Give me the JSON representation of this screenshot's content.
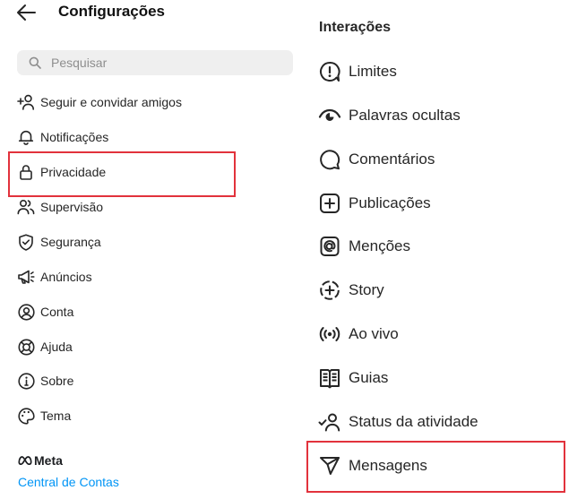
{
  "header": {
    "title": "Configurações"
  },
  "search": {
    "placeholder": "Pesquisar"
  },
  "settings_menu": [
    {
      "label": "Seguir e convidar amigos",
      "icon": "add-person-icon"
    },
    {
      "label": "Notificações",
      "icon": "bell-icon"
    },
    {
      "label": "Privacidade",
      "icon": "lock-icon",
      "highlighted": true
    },
    {
      "label": "Supervisão",
      "icon": "people-icon"
    },
    {
      "label": "Segurança",
      "icon": "shield-check-icon"
    },
    {
      "label": "Anúncios",
      "icon": "megaphone-icon"
    },
    {
      "label": "Conta",
      "icon": "person-circle-icon"
    },
    {
      "label": "Ajuda",
      "icon": "lifebuoy-icon"
    },
    {
      "label": "Sobre",
      "icon": "info-icon"
    },
    {
      "label": "Tema",
      "icon": "palette-icon"
    }
  ],
  "footer": {
    "brand": "Meta",
    "link": "Central de Contas"
  },
  "interactions": {
    "heading": "Interações",
    "items": [
      {
        "label": "Limites",
        "icon": "exclamation-circle-icon"
      },
      {
        "label": "Palavras ocultas",
        "icon": "hidden-eye-icon"
      },
      {
        "label": "Comentários",
        "icon": "comment-bubble-icon"
      },
      {
        "label": "Publicações",
        "icon": "plus-square-icon"
      },
      {
        "label": "Menções",
        "icon": "at-sign-icon"
      },
      {
        "label": "Story",
        "icon": "story-add-icon"
      },
      {
        "label": "Ao vivo",
        "icon": "live-broadcast-icon"
      },
      {
        "label": "Guias",
        "icon": "guide-book-icon"
      },
      {
        "label": "Status da atividade",
        "icon": "activity-status-icon"
      },
      {
        "label": "Mensagens",
        "icon": "paper-plane-icon",
        "highlighted": true
      }
    ]
  },
  "colors": {
    "highlight_border": "#e2323c",
    "link": "#0095f6",
    "search_bg": "#efefef"
  }
}
